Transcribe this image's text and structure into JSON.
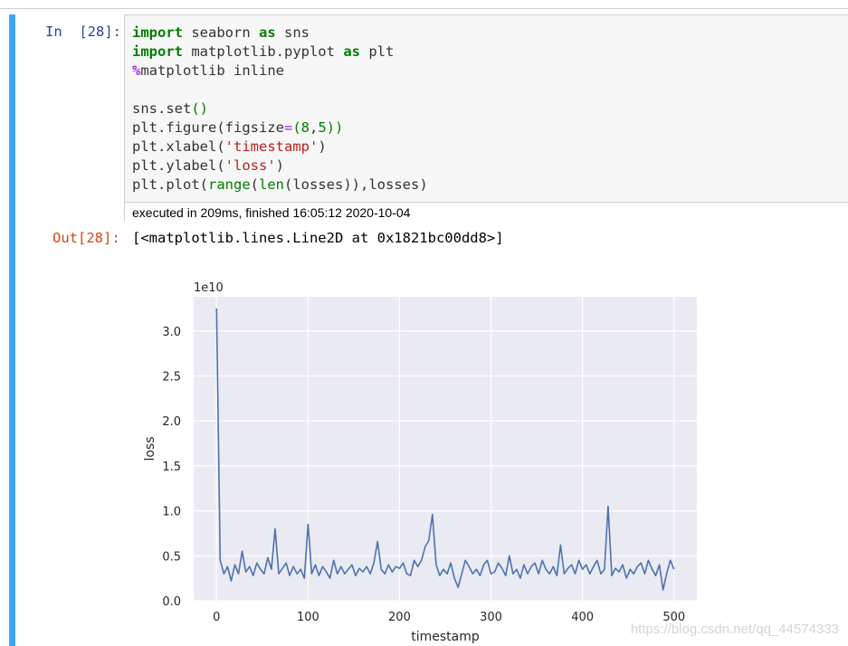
{
  "input_prompt": "In  [28]:",
  "output_prompt": "Out[28]:",
  "code_lines": [
    [
      {
        "t": "import",
        "c": "kw"
      },
      {
        "t": " seaborn ",
        "c": ""
      },
      {
        "t": "as",
        "c": "kw"
      },
      {
        "t": " sns",
        "c": ""
      }
    ],
    [
      {
        "t": "import",
        "c": "kw"
      },
      {
        "t": " matplotlib.pyplot ",
        "c": ""
      },
      {
        "t": "as",
        "c": "kw"
      },
      {
        "t": " plt",
        "c": ""
      }
    ],
    [
      {
        "t": "%",
        "c": "magic"
      },
      {
        "t": "matplotlib inline",
        "c": ""
      }
    ],
    [],
    [
      {
        "t": "sns.set",
        "c": ""
      },
      {
        "t": "()",
        "c": "par"
      }
    ],
    [
      {
        "t": "plt.figure(figsize",
        "c": ""
      },
      {
        "t": "=",
        "c": "op"
      },
      {
        "t": "(",
        "c": "par"
      },
      {
        "t": "8",
        "c": "num"
      },
      {
        "t": ",",
        "c": ""
      },
      {
        "t": "5",
        "c": "num"
      },
      {
        "t": "))",
        "c": "par"
      }
    ],
    [
      {
        "t": "plt.xlabel(",
        "c": ""
      },
      {
        "t": "'timestamp'",
        "c": "str"
      },
      {
        "t": ")",
        "c": ""
      }
    ],
    [
      {
        "t": "plt.ylabel(",
        "c": ""
      },
      {
        "t": "'loss'",
        "c": "str"
      },
      {
        "t": ")",
        "c": ""
      }
    ],
    [
      {
        "t": "plt.plot(",
        "c": ""
      },
      {
        "t": "range",
        "c": "kw2"
      },
      {
        "t": "(",
        "c": ""
      },
      {
        "t": "len",
        "c": "kw2"
      },
      {
        "t": "(losses)),losses)",
        "c": ""
      }
    ]
  ],
  "execution_info": "executed in 209ms, finished 16:05:12 2020-10-04",
  "output_text": "[<matplotlib.lines.Line2D at 0x1821bc00dd8>]",
  "watermark": "https://blog.csdn.net/qq_44574333",
  "colors": {
    "cell_bar": "#42a5f5",
    "plot_bg": "#eaeaf2",
    "line": "#4c72b0"
  },
  "chart_data": {
    "type": "line",
    "xlabel": "timestamp",
    "ylabel": "loss",
    "offset_text": "1e10",
    "xlim": [
      -25,
      525
    ],
    "ylim": [
      0,
      3.38
    ],
    "xticks": [
      0,
      100,
      200,
      300,
      400,
      500
    ],
    "yticks": [
      0.0,
      0.5,
      1.0,
      1.5,
      2.0,
      2.5,
      3.0
    ],
    "ytick_labels": [
      "0.0",
      "0.5",
      "1.0",
      "1.5",
      "2.0",
      "2.5",
      "3.0"
    ],
    "grid": true,
    "x_start": 0,
    "x_step": 4,
    "values": [
      3.25,
      0.45,
      0.3,
      0.38,
      0.22,
      0.4,
      0.3,
      0.55,
      0.32,
      0.38,
      0.28,
      0.42,
      0.35,
      0.3,
      0.48,
      0.35,
      0.8,
      0.3,
      0.36,
      0.42,
      0.28,
      0.38,
      0.3,
      0.35,
      0.25,
      0.85,
      0.3,
      0.4,
      0.28,
      0.38,
      0.32,
      0.25,
      0.45,
      0.3,
      0.38,
      0.3,
      0.35,
      0.4,
      0.28,
      0.36,
      0.32,
      0.38,
      0.3,
      0.42,
      0.66,
      0.35,
      0.3,
      0.4,
      0.32,
      0.38,
      0.36,
      0.42,
      0.3,
      0.28,
      0.45,
      0.38,
      0.45,
      0.6,
      0.67,
      0.96,
      0.4,
      0.28,
      0.35,
      0.3,
      0.42,
      0.25,
      0.15,
      0.3,
      0.45,
      0.38,
      0.3,
      0.35,
      0.28,
      0.4,
      0.45,
      0.3,
      0.32,
      0.42,
      0.36,
      0.28,
      0.5,
      0.3,
      0.35,
      0.25,
      0.4,
      0.3,
      0.38,
      0.42,
      0.3,
      0.45,
      0.35,
      0.3,
      0.38,
      0.28,
      0.62,
      0.3,
      0.36,
      0.4,
      0.3,
      0.45,
      0.35,
      0.4,
      0.3,
      0.38,
      0.45,
      0.3,
      0.35,
      1.05,
      0.28,
      0.36,
      0.32,
      0.4,
      0.25,
      0.35,
      0.3,
      0.38,
      0.42,
      0.3,
      0.45,
      0.35,
      0.28,
      0.4,
      0.12,
      0.3,
      0.45,
      0.35
    ]
  }
}
